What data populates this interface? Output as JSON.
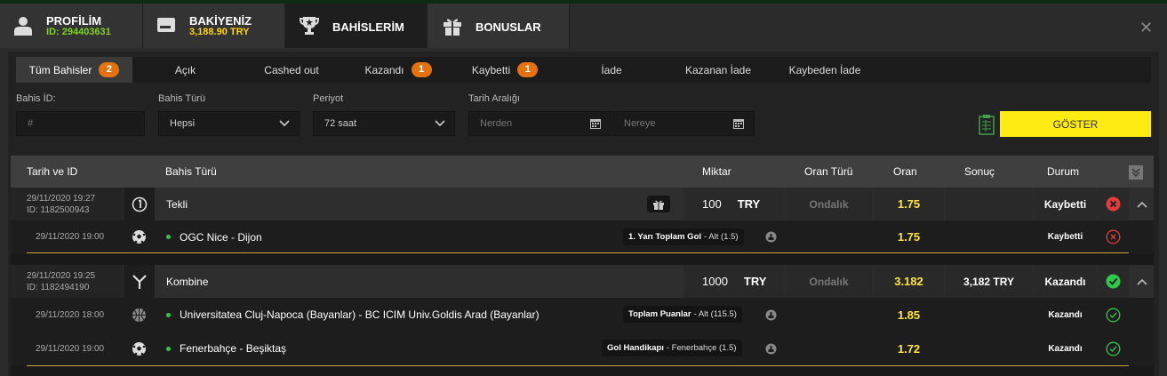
{
  "nav": {
    "profile_title": "PROFİLİM",
    "profile_id": "ID: 294403631",
    "balance_title": "BAKİYENİZ",
    "balance_value": "3,188.90 TRY",
    "bets_title": "BAHİSLERİM",
    "bonus_title": "BONUSLAR"
  },
  "tabs": [
    {
      "label": "Tüm Bahisler",
      "badge": "2"
    },
    {
      "label": "Açık"
    },
    {
      "label": "Cashed out"
    },
    {
      "label": "Kazandı",
      "badge": "1"
    },
    {
      "label": "Kaybetti",
      "badge": "1"
    },
    {
      "label": "İade"
    },
    {
      "label": "Kazanan İade"
    },
    {
      "label": "Kaybeden İade"
    }
  ],
  "filters": {
    "bet_id_label": "Bahis İD:",
    "bet_id_placeholder": "#",
    "bet_type_label": "Bahis Türü",
    "bet_type_value": "Hepsi",
    "period_label": "Periyot",
    "period_value": "72 saat",
    "date_range_label": "Tarih Aralığı",
    "from_placeholder": "Nerden",
    "to_placeholder": "Nereye",
    "show_button": "GÖSTER"
  },
  "table": {
    "headers": {
      "date_id": "Tarih ve ID",
      "bet_type": "Bahis Türü",
      "amount": "Miktar",
      "odds_type": "Oran Türü",
      "odds": "Oran",
      "result": "Sonuç",
      "status": "Durum"
    },
    "bets": [
      {
        "date": "29/11/2020 19:27",
        "id": "ID: 1182500943",
        "type": "Tekli",
        "amount": "100",
        "currency": "TRY",
        "odds_type": "Ondalık",
        "odds": "1.75",
        "result": "",
        "status": "Kaybetti",
        "selections": [
          {
            "date": "29/11/2020 19:00",
            "match": "OGC Nice - Dijon",
            "market": "1. Yarı Toplam Gol",
            "pick": "- Alt (1.5)",
            "odds": "1.75",
            "status": "Kaybetti"
          }
        ]
      },
      {
        "date": "29/11/2020 19:25",
        "id": "ID: 1182494190",
        "type": "Kombine",
        "amount": "1000",
        "currency": "TRY",
        "odds_type": "Ondalık",
        "odds": "3.182",
        "result": "3,182 TRY",
        "status": "Kazandı",
        "selections": [
          {
            "date": "29/11/2020 18:00",
            "match": "Universitatea Cluj-Napoca (Bayanlar) - BC ICIM Univ.Goldis Arad (Bayanlar)",
            "market": "Toplam Puanlar",
            "pick": "- Alt (115.5)",
            "odds": "1.85",
            "status": "Kazandı"
          },
          {
            "date": "29/11/2020 19:00",
            "match": "Fenerbahçe - Beşiktaş",
            "market": "Gol Handikapı",
            "pick": "- Fenerbahçe (1.5)",
            "odds": "1.72",
            "status": "Kazandı"
          }
        ]
      }
    ]
  },
  "colors": {
    "accent_yellow": "#ffeb14",
    "badge_orange": "#e4720e",
    "win_green": "#2ec84a",
    "loss_red": "#e03c3c",
    "profile_id_green": "#7ed321"
  }
}
